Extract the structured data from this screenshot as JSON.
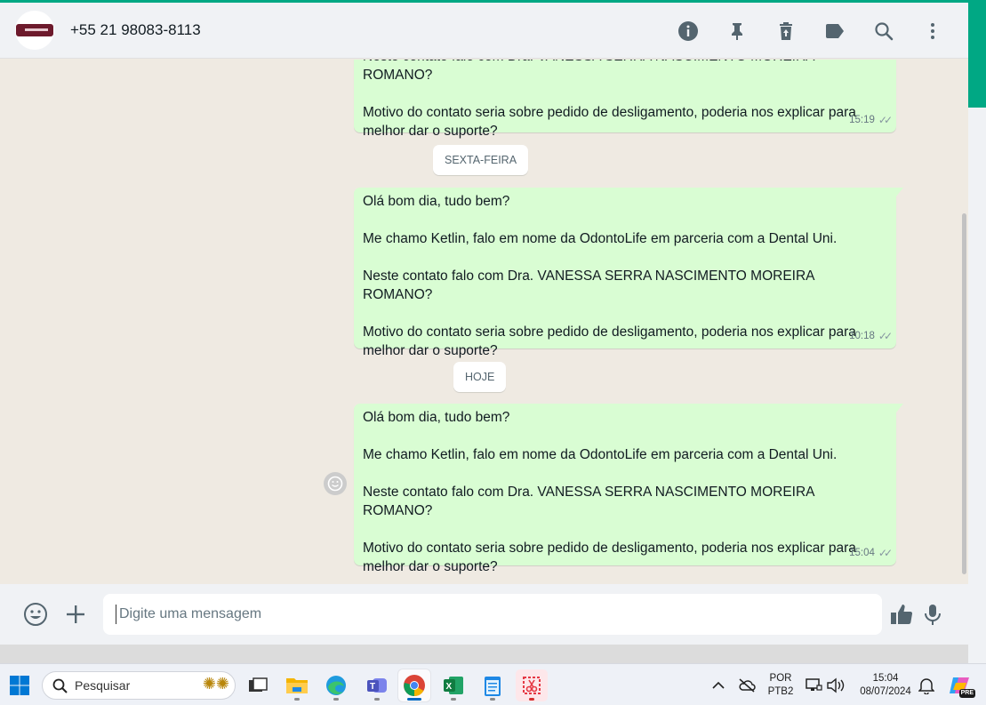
{
  "header": {
    "contact_name": "+55 21 98083-8113"
  },
  "messages": [
    {
      "text": "Neste contato falo com Dra. VANESSA SERRA NASCIMENTO MOREIRA ROMANO?\n\nMotivo do contato seria sobre pedido de desligamento, poderia nos explicar para melhor dar o suporte?",
      "time": "15:19"
    },
    {
      "text": "Olá bom dia, tudo bem?\n\nMe chamo Ketlin, falo em nome da OdontoLife em parceria com a Dental Uni.\n\nNeste contato falo com Dra. VANESSA SERRA NASCIMENTO MOREIRA ROMANO?\n\nMotivo do contato seria sobre pedido de desligamento, poderia nos explicar para melhor dar o suporte?",
      "time": "10:18"
    },
    {
      "text": "Olá bom dia, tudo bem?\n\nMe chamo Ketlin, falo em nome da OdontoLife em parceria com a Dental Uni.\n\nNeste contato falo com Dra. VANESSA SERRA NASCIMENTO MOREIRA ROMANO?\n\nMotivo do contato seria sobre pedido de desligamento, poderia nos explicar para melhor dar o suporte?",
      "time": "15:04"
    }
  ],
  "day_labels": {
    "friday": "SEXTA-FEIRA",
    "today": "HOJE"
  },
  "composer": {
    "placeholder": "Digite uma mensagem"
  },
  "taskbar": {
    "search_label": "Pesquisar",
    "lang_top": "POR",
    "lang_bottom": "PTB2",
    "clock_time": "15:04",
    "clock_date": "08/07/2024",
    "copilot_badge": "PRE"
  },
  "colors": {
    "accent": "#00a884",
    "bubble_out": "#d9fdd3",
    "chat_bg": "#efeae2",
    "panel_bg": "#f0f2f5"
  }
}
